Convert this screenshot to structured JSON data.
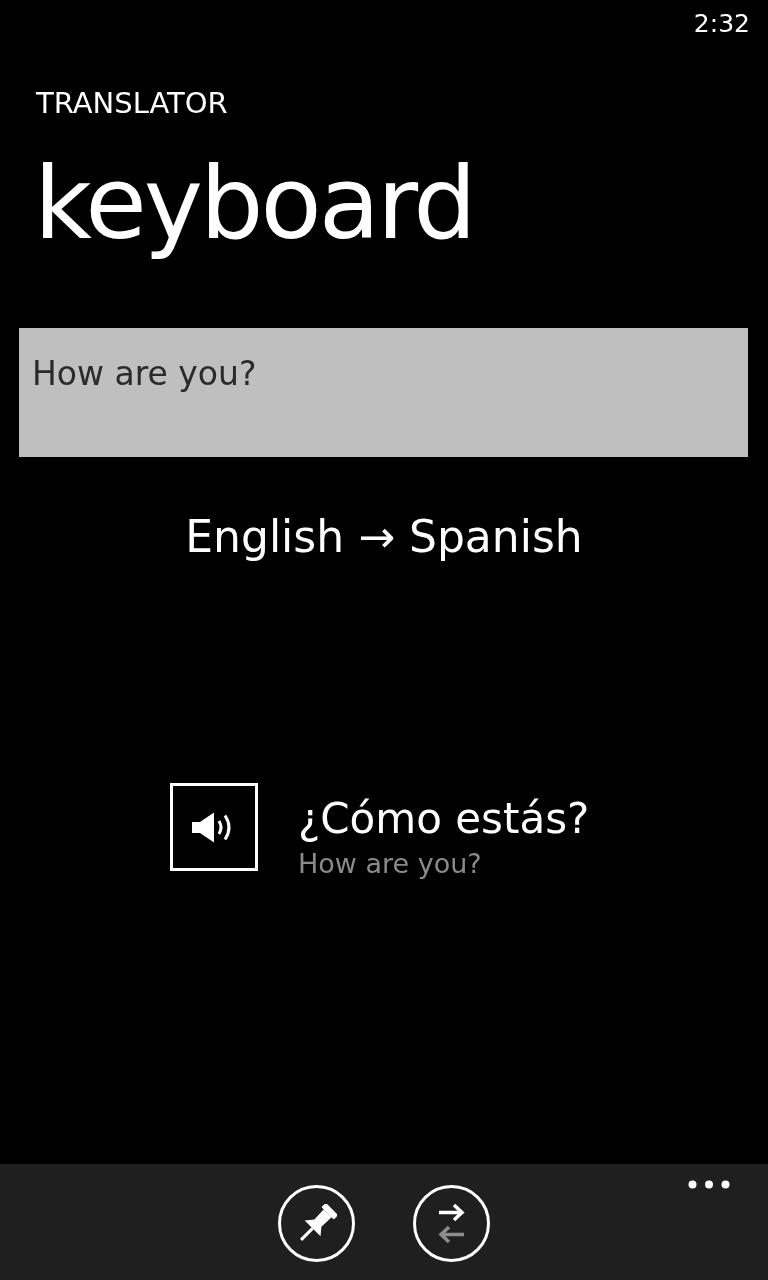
{
  "status_bar": {
    "time": "2:32"
  },
  "header": {
    "app_title": "TRANSLATOR",
    "page_title": "keyboard"
  },
  "input": {
    "value": "How are you?"
  },
  "language_pair": "English → Spanish",
  "result": {
    "translation": "¿Cómo estás?",
    "source": "How are you?"
  }
}
